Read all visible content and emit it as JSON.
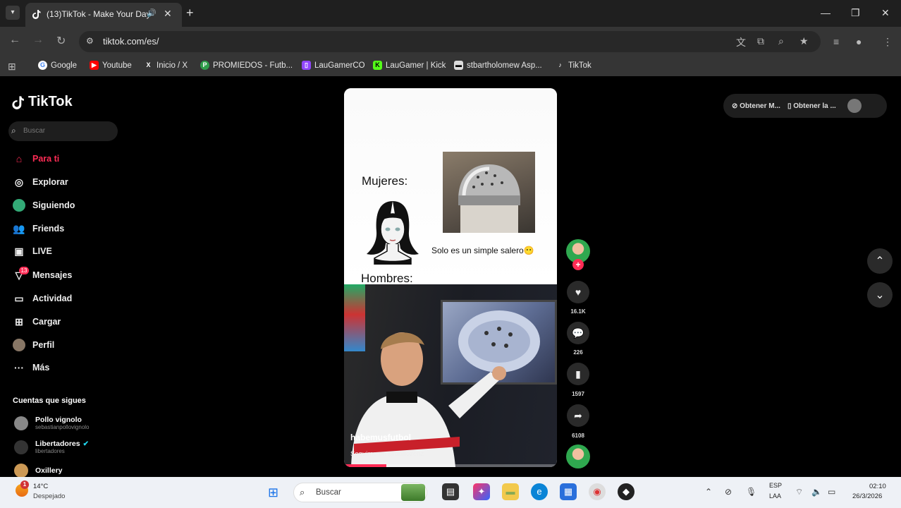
{
  "browser": {
    "tab_title": "(13)TikTok - Make Your Day",
    "tab_menu_icon": "chevron-down-icon",
    "url": "tiktok.com/es/",
    "bookmarks": [
      "Google",
      "Youtube",
      "Inicio / X",
      "PROMIEDOS - Futb...",
      "LauGamerCO",
      "LauGamer | Kick",
      "stbartholomew Asp...",
      "TikTok"
    ]
  },
  "tiktok": {
    "logo_text": "TikTok",
    "search_placeholder": "Buscar",
    "nav": [
      "Para ti",
      "Explorar",
      "Siguiendo",
      "Friends",
      "LIVE",
      "Mensajes",
      "Actividad",
      "Cargar",
      "Perfil",
      "Más"
    ],
    "messages_badge": "13",
    "following_heading": "Cuentas que sigues",
    "accounts": [
      {
        "name": "Pollo vignolo",
        "handle": "sebastianpollovignolo",
        "verified": false
      },
      {
        "name": "Libertadores",
        "handle": "libertadores",
        "verified": true
      },
      {
        "name": "Oxillery",
        "handle": "",
        "verified": false
      }
    ],
    "top_right": {
      "get_pc_app": "Obtener M...",
      "get_mobile_app": "Obtener la ..."
    },
    "accent_color": "#fe2c55"
  },
  "video": {
    "meme_label_women": "Mujeres:",
    "meme_label_men": "Hombres:",
    "meme_caption": "Solo es un simple salero😶",
    "overlay_handle": "habemusfutbol",
    "overlay_text": "Seguime en @dariozenz",
    "progress": 0.2,
    "stats": {
      "likes": "16.1K",
      "comments": "226",
      "saves": "1597",
      "shares": "6108"
    }
  },
  "taskbar": {
    "temperature": "14°C",
    "condition": "Despejado",
    "weather_badge": "1",
    "search_label": "Buscar",
    "lang_line1": "ESP",
    "lang_line2": "LAA",
    "time": "02:10",
    "date": "26/3/2026"
  }
}
